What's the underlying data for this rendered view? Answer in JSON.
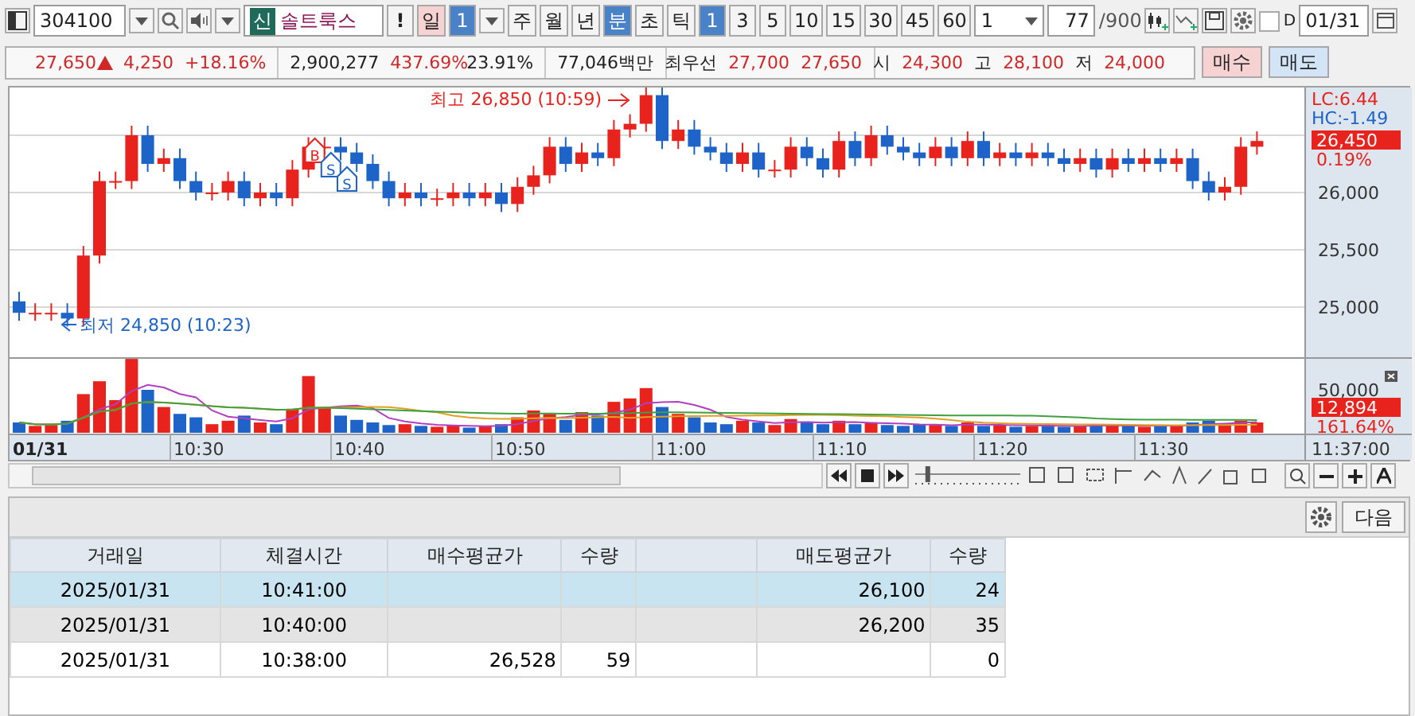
{
  "toolbar": {
    "stock_code": "304100",
    "market_badge": "신",
    "stock_name": "솔트룩스",
    "alert_button": "!",
    "periods": [
      {
        "label": "일",
        "selected": false,
        "kind": "pink"
      },
      {
        "label": "주",
        "selected": false,
        "kind": "plain"
      },
      {
        "label": "월",
        "selected": false,
        "kind": "plain"
      },
      {
        "label": "년",
        "selected": false,
        "kind": "plain"
      },
      {
        "label": "분",
        "selected": true,
        "kind": "plain"
      },
      {
        "label": "초",
        "selected": false,
        "kind": "plain"
      },
      {
        "label": "틱",
        "selected": false,
        "kind": "plain"
      }
    ],
    "intervals": [
      {
        "label": "1",
        "selected": true
      },
      {
        "label": "3",
        "selected": false
      },
      {
        "label": "5",
        "selected": false
      },
      {
        "label": "10",
        "selected": false
      },
      {
        "label": "15",
        "selected": false
      },
      {
        "label": "30",
        "selected": false
      },
      {
        "label": "45",
        "selected": false
      },
      {
        "label": "60",
        "selected": false
      }
    ],
    "day_count": "1",
    "interval_select": "1",
    "count": "77",
    "count_max": "/900",
    "d_checkbox": {
      "label": "D",
      "checked": false
    },
    "date": "01/31"
  },
  "quote": {
    "price": "27,650",
    "change": "4,250",
    "rate": "+18.16%",
    "volume": "2,900,277",
    "volume_rate": "437.69%",
    "turnover": "23.91%",
    "amount": "77,046백만",
    "best_label": "최우선",
    "best_ask": "27,700",
    "best_bid": "27,650",
    "open_label": "시",
    "open": "24,300",
    "high_label": "고",
    "high": "28,100",
    "low_label": "저",
    "low": "24,000",
    "buy_button": "매수",
    "sell_button": "매도"
  },
  "chart": {
    "high_note": "최고 26,850 (10:59)",
    "low_note": "최저 24,850 (10:23)",
    "lc": "LC:6.44",
    "hc": "HC:-1.49",
    "last_price": "26,450",
    "last_rate": "0.19%",
    "price_ticks": [
      "26,000",
      "25,500",
      "25,000"
    ],
    "volume_tick": "50,000",
    "last_volume": "12,894",
    "volume_rate": "161.64%",
    "date_label": "01/31",
    "time_ticks": [
      "10:30",
      "10:40",
      "10:50",
      "11:00",
      "11:10",
      "11:20",
      "11:30"
    ],
    "end_time": "11:37:00",
    "markers": [
      {
        "label": "B"
      },
      {
        "label": "S"
      },
      {
        "label": "S"
      }
    ]
  },
  "controls": {
    "zoom_slider": {
      "level": 0.1
    }
  },
  "panel": {
    "next_button": "다음"
  },
  "table": {
    "columns": [
      "거래일",
      "체결시간",
      "매수평균가",
      "수량",
      "매도평균가",
      "수량"
    ],
    "rows": [
      {
        "date": "2025/01/31",
        "time": "10:41:00",
        "sell_avg": "26,100",
        "sell_qty": "24",
        "selected": true
      },
      {
        "date": "2025/01/31",
        "time": "10:40:00",
        "sell_avg": "26,200",
        "sell_qty": "35",
        "selected": false
      },
      {
        "date": "2025/01/31",
        "time": "10:38:00",
        "buy_avg": "26,528",
        "buy_qty": "59",
        "sell_qty": "0",
        "selected": false
      }
    ]
  }
}
